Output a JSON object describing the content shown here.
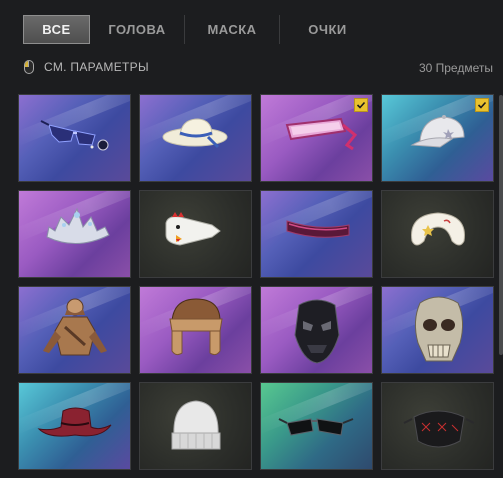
{
  "tabs": [
    {
      "label": "ВСЕ",
      "active": true
    },
    {
      "label": "ГОЛОВА",
      "active": false
    },
    {
      "label": "МАСКА",
      "active": false
    },
    {
      "label": "ОЧКИ",
      "active": false
    }
  ],
  "filter": {
    "label": "СМ. ПАРАМЕТРЫ",
    "icon": "mouse-icon"
  },
  "item_count": "30 Предметы",
  "colors": {
    "accent": "#e9c22e",
    "background": "#1c1d1f",
    "tab_active": "#5c5c5c"
  },
  "items": [
    {
      "name": "glasses-and-ornament",
      "bg": "purple",
      "checked": false
    },
    {
      "name": "sun-hat",
      "bg": "purple",
      "checked": false
    },
    {
      "name": "pink-visor-goggles",
      "bg": "pink",
      "checked": true
    },
    {
      "name": "white-cap",
      "bg": "teal",
      "checked": true
    },
    {
      "name": "silver-tiara",
      "bg": "pink",
      "checked": false
    },
    {
      "name": "chicken-mask",
      "bg": "dark",
      "checked": false
    },
    {
      "name": "purple-visor",
      "bg": "purple",
      "checked": false
    },
    {
      "name": "neck-pillow",
      "bg": "dark",
      "checked": false
    },
    {
      "name": "desert-outfit",
      "bg": "purple",
      "checked": false
    },
    {
      "name": "fur-ushanka",
      "bg": "pink",
      "checked": false
    },
    {
      "name": "black-face-mask",
      "bg": "pink",
      "checked": false
    },
    {
      "name": "skull-mask",
      "bg": "purple",
      "checked": false
    },
    {
      "name": "cowboy-hat",
      "bg": "teal",
      "checked": false
    },
    {
      "name": "knit-beanie",
      "bg": "dark",
      "checked": false
    },
    {
      "name": "black-sunglasses",
      "bg": "green",
      "checked": false
    },
    {
      "name": "black-face-cover",
      "bg": "dark",
      "checked": false
    }
  ]
}
